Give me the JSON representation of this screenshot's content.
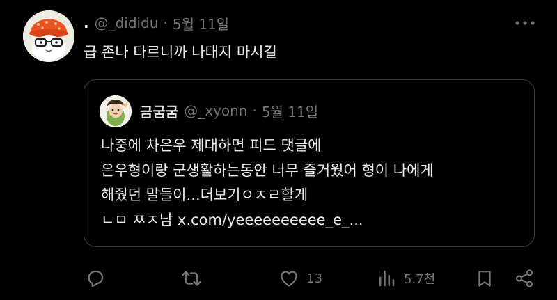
{
  "tweet": {
    "handle": "@_dididu",
    "dot": "·",
    "time": "5월 11일",
    "text": "급 존나 다르니까 나대지 마시길"
  },
  "quote": {
    "display_name": "금굼굼",
    "handle": "@_xyonn",
    "dot": "·",
    "time": "5월 11일",
    "lines": [
      "나중에 차은우 제대하면 피드 댓글에",
      "은우형이랑 군생활하는동안 너무 즐거웠어 형이 나에게",
      "해줬던 말들이...더보기ㅇㅈㄹ할게",
      "ㄴㅁ ㅉㅈ남 x.com/yeeeeeeeeee_e_..."
    ]
  },
  "actions": {
    "reply": {
      "icon": "reply-icon"
    },
    "retweet": {
      "icon": "retweet-icon"
    },
    "like": {
      "icon": "heart-icon",
      "count": "13"
    },
    "views": {
      "icon": "views-icon",
      "count": "5.7천"
    },
    "bookmark": {
      "icon": "bookmark-icon"
    },
    "share": {
      "icon": "share-icon"
    }
  },
  "colors": {
    "background": "#000000",
    "text": "#e7e9ea",
    "secondary": "#71767b",
    "border": "#3a3d41"
  }
}
